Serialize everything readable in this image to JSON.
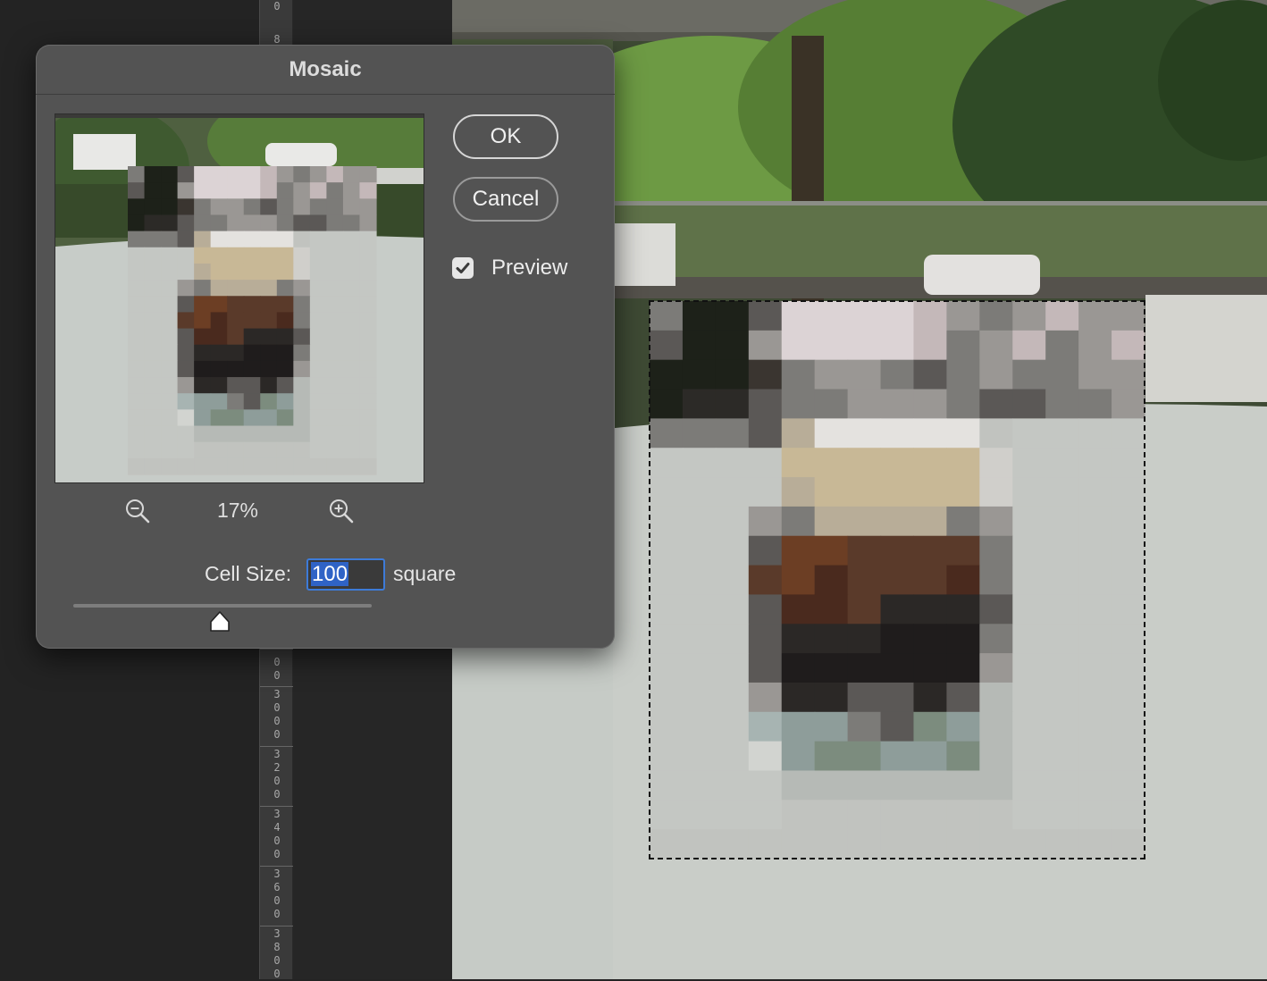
{
  "dialog": {
    "title": "Mosaic",
    "ok_label": "OK",
    "cancel_label": "Cancel",
    "preview_label": "Preview",
    "preview_checked": true,
    "zoom_level": "17%",
    "cell_size_label": "Cell Size:",
    "cell_size_value": "100",
    "cell_size_unit": "square",
    "slider_fraction": 0.49
  },
  "icons": {
    "zoom_out": "zoom-out-icon",
    "zoom_in": "zoom-in-icon",
    "checkbox": "checkmark-icon",
    "slider": "slider-thumb"
  },
  "ruler": {
    "labels": [
      "0",
      "8",
      "0\n0",
      "3\n0\n0\n0",
      "3\n2\n0\n0",
      "3\n4\n0\n0",
      "3\n6\n0\n0",
      "3\n8\n0\n0"
    ]
  },
  "colors": {
    "dialog_bg": "#535353",
    "workspace_bg": "#232323",
    "accent_focus": "#3d7bd8"
  }
}
